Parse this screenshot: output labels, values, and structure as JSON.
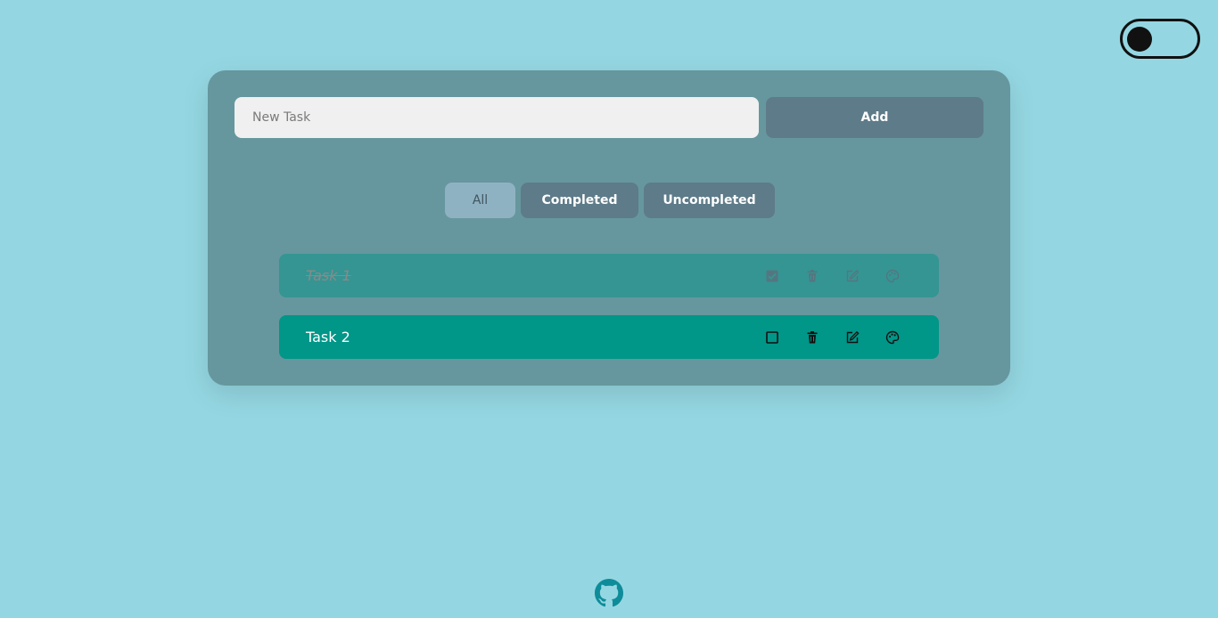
{
  "input": {
    "placeholder": "New Task",
    "value": ""
  },
  "add_label": "Add",
  "filters": [
    {
      "label": "All",
      "active": true
    },
    {
      "label": "Completed",
      "active": false
    },
    {
      "label": "Uncompleted",
      "active": false
    }
  ],
  "tasks": [
    {
      "title": "Task 1",
      "completed": true
    },
    {
      "title": "Task 2",
      "completed": false
    }
  ],
  "icons": {
    "checkbox_checked": "checkbox-checked-icon",
    "checkbox_empty": "checkbox-empty-icon",
    "delete": "trash-icon",
    "edit": "edit-icon",
    "color": "palette-icon",
    "github": "github-icon"
  },
  "theme": {
    "background": "#94d7e2",
    "card": "#66979e",
    "button": "#5e7b89",
    "task_done": "#359593",
    "task_open": "#009688"
  }
}
